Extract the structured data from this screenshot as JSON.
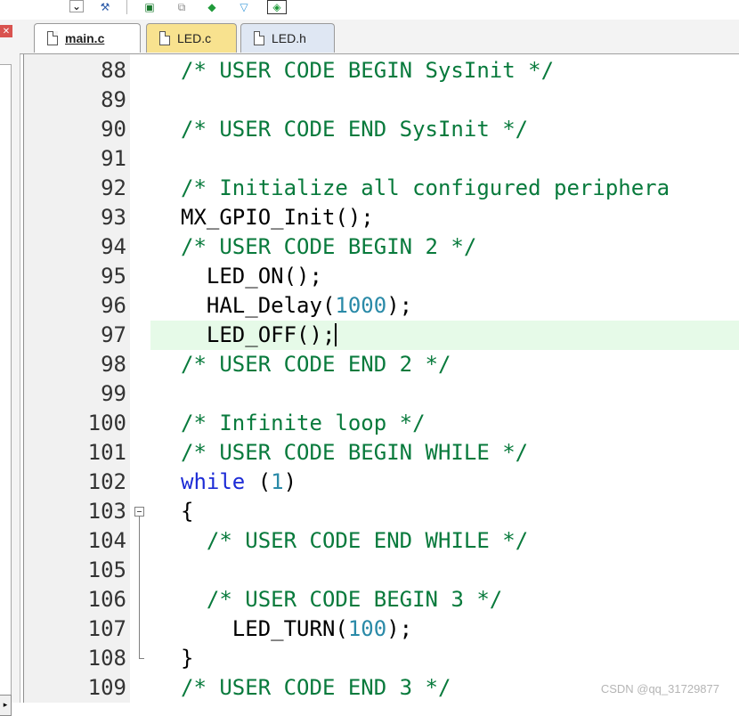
{
  "toolbar": {
    "icons": [
      "dropdown-icon",
      "wizard-icon",
      "window-layout-icon",
      "configure-icon",
      "pack-installer-icon",
      "filter-icon",
      "manage-run-time-icon"
    ]
  },
  "tabs": [
    {
      "label": "main.c",
      "active": true
    },
    {
      "label": "LED.c",
      "active": false
    },
    {
      "label": "LED.h",
      "active": false
    }
  ],
  "editor": {
    "current_line": 97,
    "lines": [
      {
        "n": "88",
        "code": "/* USER CODE BEGIN SysInit */"
      },
      {
        "n": "89",
        "code": ""
      },
      {
        "n": "90",
        "code": "/* USER CODE END SysInit */"
      },
      {
        "n": "91",
        "code": ""
      },
      {
        "n": "92",
        "code": "/* Initialize all configured periphera"
      },
      {
        "n": "93",
        "code": "MX_GPIO_Init();"
      },
      {
        "n": "94",
        "code": "/* USER CODE BEGIN 2 */"
      },
      {
        "n": "95",
        "code": "  LED_ON();"
      },
      {
        "n": "96",
        "code": "  HAL_Delay(1000);"
      },
      {
        "n": "97",
        "code": "  LED_OFF();"
      },
      {
        "n": "98",
        "code": "/* USER CODE END 2 */"
      },
      {
        "n": "99",
        "code": ""
      },
      {
        "n": "100",
        "code": "/* Infinite loop */"
      },
      {
        "n": "101",
        "code": "/* USER CODE BEGIN WHILE */"
      },
      {
        "n": "102",
        "code": "while (1)"
      },
      {
        "n": "103",
        "code": "{"
      },
      {
        "n": "104",
        "code": "  /* USER CODE END WHILE */"
      },
      {
        "n": "105",
        "code": ""
      },
      {
        "n": "106",
        "code": "  /* USER CODE BEGIN 3 */"
      },
      {
        "n": "107",
        "code": "    LED_TURN(100);"
      },
      {
        "n": "108",
        "code": "}"
      },
      {
        "n": "109",
        "code": "/* USER CODE END 3 */"
      }
    ]
  },
  "watermark": "CSDN @qq_31729877",
  "colors": {
    "comment": "#087a3c",
    "keyword": "#1c2bd6",
    "number": "#2a8aa8",
    "current_line_bg": "#e6fae8",
    "gutter_bg": "#f1f1f1",
    "tab_led_c": "#f8e28f",
    "tab_led_h": "#dfe7f3"
  }
}
